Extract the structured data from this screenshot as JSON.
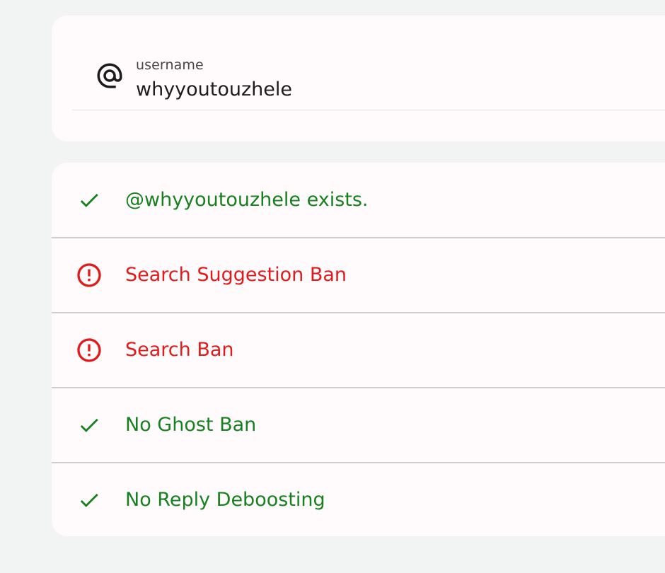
{
  "username_field": {
    "label": "username",
    "value": "whyyoutouzhele",
    "icon": "at-icon"
  },
  "results": [
    {
      "text": "@whyyoutouzhele exists.",
      "status": "ok",
      "icon": "check-icon"
    },
    {
      "text": "Search Suggestion Ban",
      "status": "bad",
      "icon": "error-icon"
    },
    {
      "text": "Search Ban",
      "status": "bad",
      "icon": "error-icon"
    },
    {
      "text": "No Ghost Ban",
      "status": "ok",
      "icon": "check-icon"
    },
    {
      "text": "No Reply Deboosting",
      "status": "ok",
      "icon": "check-icon"
    }
  ],
  "colors": {
    "ok": "#17811f",
    "bad": "#e11b1b",
    "background": "#f2f3f3",
    "card": "#fffbfd"
  }
}
